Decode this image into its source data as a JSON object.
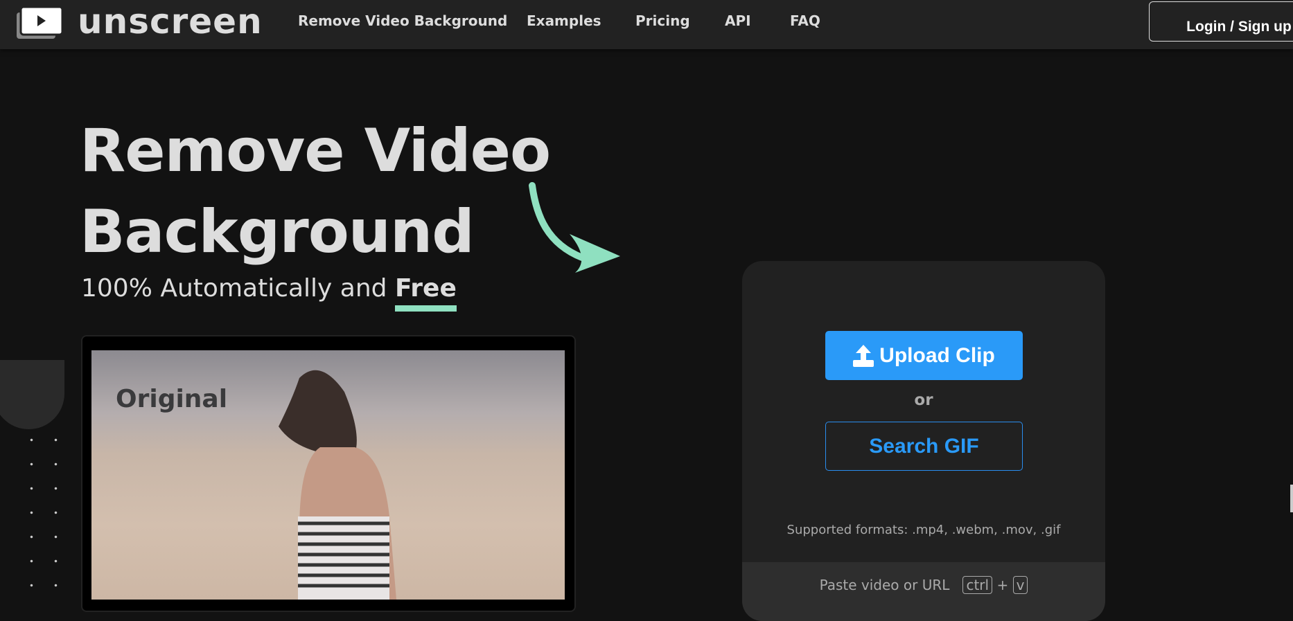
{
  "nav": {
    "brand": "unscreen",
    "links": [
      "Remove Video Background",
      "Examples",
      "Pricing",
      "API",
      "FAQ"
    ],
    "login": "Login / Sign up"
  },
  "hero": {
    "title_line1": "Remove Video",
    "title_line2": "Background",
    "subtitle": "100% Automatically and",
    "subtitle_highlight": "Free",
    "preview_label": "Original"
  },
  "card": {
    "upload": "Upload Clip",
    "or": "or",
    "search": "Search GIF",
    "formats": "Supported formats: .mp4, .webm, .mov, .gif",
    "paste": "Paste video or URL",
    "key1": "ctrl",
    "plus": "+",
    "key2": "v"
  },
  "colors": {
    "accent": "#2a9af8",
    "highlight": "#8fe0c0",
    "bg": "#121212"
  }
}
